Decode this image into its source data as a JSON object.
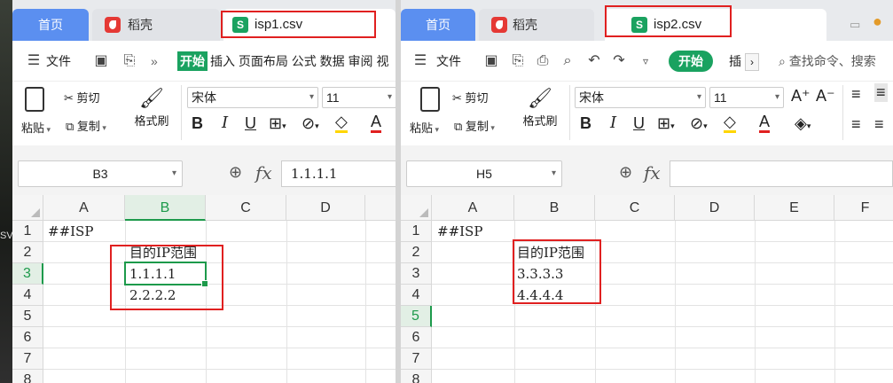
{
  "desktop": {
    "label": "SV"
  },
  "left_window": {
    "tabs": {
      "home": "首页",
      "daoke": "稻壳",
      "file": "isp1.csv",
      "file_icon": "S"
    },
    "menu": {
      "file": "文件",
      "more": "»",
      "start": "开始",
      "items": "插入 页面布局 公式 数据 审阅 视"
    },
    "ribbon": {
      "paste": "粘贴",
      "cut": "剪切",
      "copy": "复制",
      "format_painter": "格式刷",
      "font": "宋体",
      "font_size": "11",
      "bold": "B",
      "italic": "I",
      "underline": "U",
      "font_color": "A"
    },
    "formula_bar": {
      "name_box": "B3",
      "fx": "fx",
      "value": "1.1.1.1"
    },
    "columns": [
      "A",
      "B",
      "C",
      "D"
    ],
    "rows": [
      "1",
      "2",
      "3",
      "4",
      "5",
      "6",
      "7",
      "8"
    ],
    "cells": {
      "A1": "##ISP",
      "B2": "目的IP范围",
      "B3": "1.1.1.1",
      "B4": "2.2.2.2"
    }
  },
  "right_window": {
    "tabs": {
      "home": "首页",
      "daoke": "稻壳",
      "file": "isp2.csv",
      "file_icon": "S"
    },
    "menu": {
      "file": "文件",
      "start": "开始",
      "insert": "插",
      "search": "查找命令、搜索"
    },
    "ribbon": {
      "paste": "粘贴",
      "cut": "剪切",
      "copy": "复制",
      "format_painter": "格式刷",
      "font": "宋体",
      "font_size": "11",
      "grow": "A⁺",
      "shrink": "A⁻",
      "bold": "B",
      "italic": "I",
      "underline": "U",
      "font_color": "A"
    },
    "formula_bar": {
      "name_box": "H5",
      "fx": "fx",
      "value": ""
    },
    "columns": [
      "A",
      "B",
      "C",
      "D",
      "E",
      "F"
    ],
    "rows": [
      "1",
      "2",
      "3",
      "4",
      "5",
      "6",
      "7",
      "8"
    ],
    "cells": {
      "A1": "##ISP",
      "B2": "目的IP范围",
      "B3": "3.3.3.3",
      "B4": "4.4.4.4"
    }
  },
  "colors": {
    "accent_green": "#1aa260",
    "home_tab": "#5b8ff0",
    "highlight_red": "#e02020"
  }
}
